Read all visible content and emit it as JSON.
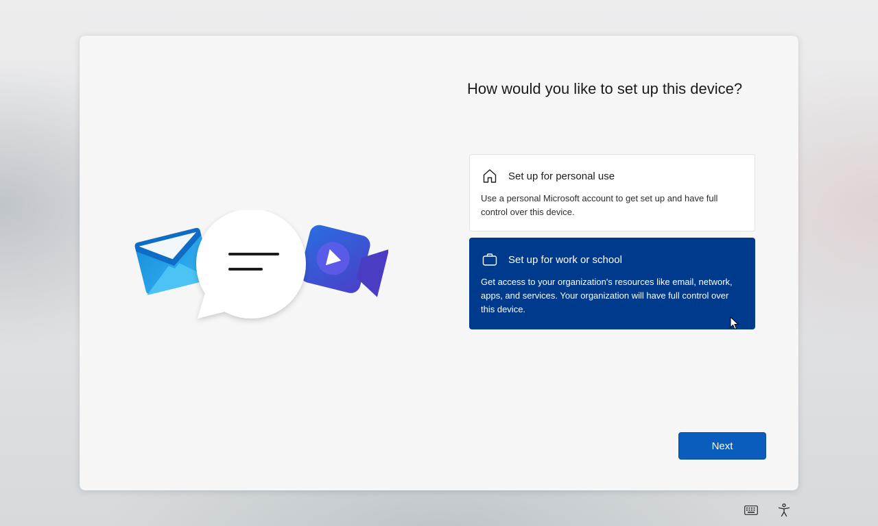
{
  "setup": {
    "title": "How would you like to set up this device?",
    "options": [
      {
        "title": "Set up for personal use",
        "description": "Use a personal Microsoft account to get set up and have full control over this device.",
        "icon": "home-icon",
        "selected": false
      },
      {
        "title": "Set up for work or school",
        "description": "Get access to your organization's resources like email, network, apps, and services. Your organization will have full control over this device.",
        "icon": "briefcase-icon",
        "selected": true
      }
    ],
    "next_label": "Next"
  },
  "illustration": {
    "icons": [
      "mail-icon",
      "chat-bubble-icon",
      "video-camera-icon"
    ]
  },
  "tray": {
    "icons": [
      "keyboard-icon",
      "accessibility-icon"
    ]
  },
  "colors": {
    "selected_option": "#003a8c",
    "next_button": "#0a5cbd",
    "card": "#f6f6f6"
  }
}
